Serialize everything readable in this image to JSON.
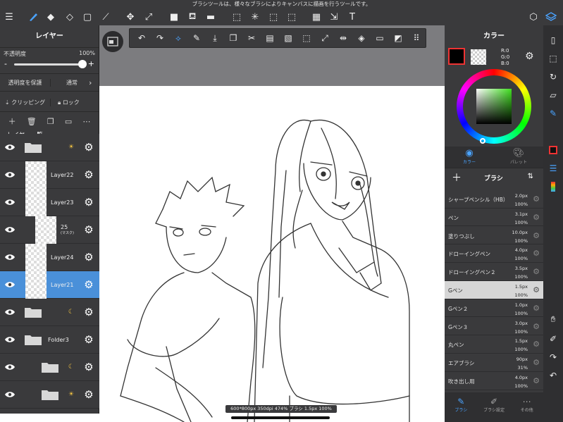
{
  "tip": "ブラシツールは、様々なブラシによりキャンバスに描画を行うツールです。",
  "left_panel": {
    "title": "レイヤー",
    "opacity_label": "不透明度",
    "opacity_value": "100%",
    "opacity_level": 1.0,
    "minus": "-",
    "plus": "+",
    "protect_label": "透明度を保護",
    "blend_label": "通常",
    "clipping_label": "クリッピング",
    "lock_label": "ロック",
    "list_title": "レイヤー一覧",
    "layers": [
      {
        "name": "",
        "type": "folder",
        "mark": "☀"
      },
      {
        "name": "Layer22",
        "type": "layer"
      },
      {
        "name": "Layer23",
        "type": "layer"
      },
      {
        "name": "25",
        "sub": "(マスク)",
        "type": "layer"
      },
      {
        "name": "Layer24",
        "type": "layer"
      },
      {
        "name": "Layer21",
        "type": "layer",
        "selected": true
      },
      {
        "name": "",
        "type": "folder",
        "mark": "☾"
      },
      {
        "name": "Folder3",
        "type": "folder"
      },
      {
        "name": "",
        "type": "folder",
        "mark": "☾"
      },
      {
        "name": "",
        "type": "folder",
        "mark": "☀"
      }
    ]
  },
  "right_panel": {
    "title": "カラー",
    "rgb": {
      "r": "R:0",
      "g": "G:0",
      "b": "B:0"
    },
    "tabs": {
      "color": "カラー",
      "palette": "パレット"
    },
    "brush_title": "ブラシ",
    "brushes": [
      {
        "name": "シャープペンシル（HB）",
        "size": "2.0px",
        "opacity": "100%"
      },
      {
        "name": "ペン",
        "size": "3.1px",
        "opacity": "100%"
      },
      {
        "name": "塗りつぶし",
        "size": "10.0px",
        "opacity": "100%"
      },
      {
        "name": "ドローイングペン",
        "size": "4.0px",
        "opacity": "100%"
      },
      {
        "name": "ドローイングペン２",
        "size": "3.5px",
        "opacity": "100%"
      },
      {
        "name": "Gペン",
        "size": "1.5px",
        "opacity": "100%",
        "selected": true
      },
      {
        "name": "Gペン２",
        "size": "1.0px",
        "opacity": "100%"
      },
      {
        "name": "Gペン３",
        "size": "3.0px",
        "opacity": "100%"
      },
      {
        "name": "丸ペン",
        "size": "1.5px",
        "opacity": "100%"
      },
      {
        "name": "エアブラシ",
        "size": "90px",
        "opacity": "31%"
      },
      {
        "name": "吹き出し用",
        "size": "4.0px",
        "opacity": "100%"
      }
    ],
    "bottom": {
      "brush": "ブラシ",
      "settings": "ブラシ設定",
      "other": "その他"
    }
  },
  "status": "600*800px 350dpi 474% ブラシ 1.5px 100%",
  "colors": {
    "bg": "#3a3a3c",
    "accent": "#4a90d9",
    "selected_brush": "#d6d6d6"
  }
}
